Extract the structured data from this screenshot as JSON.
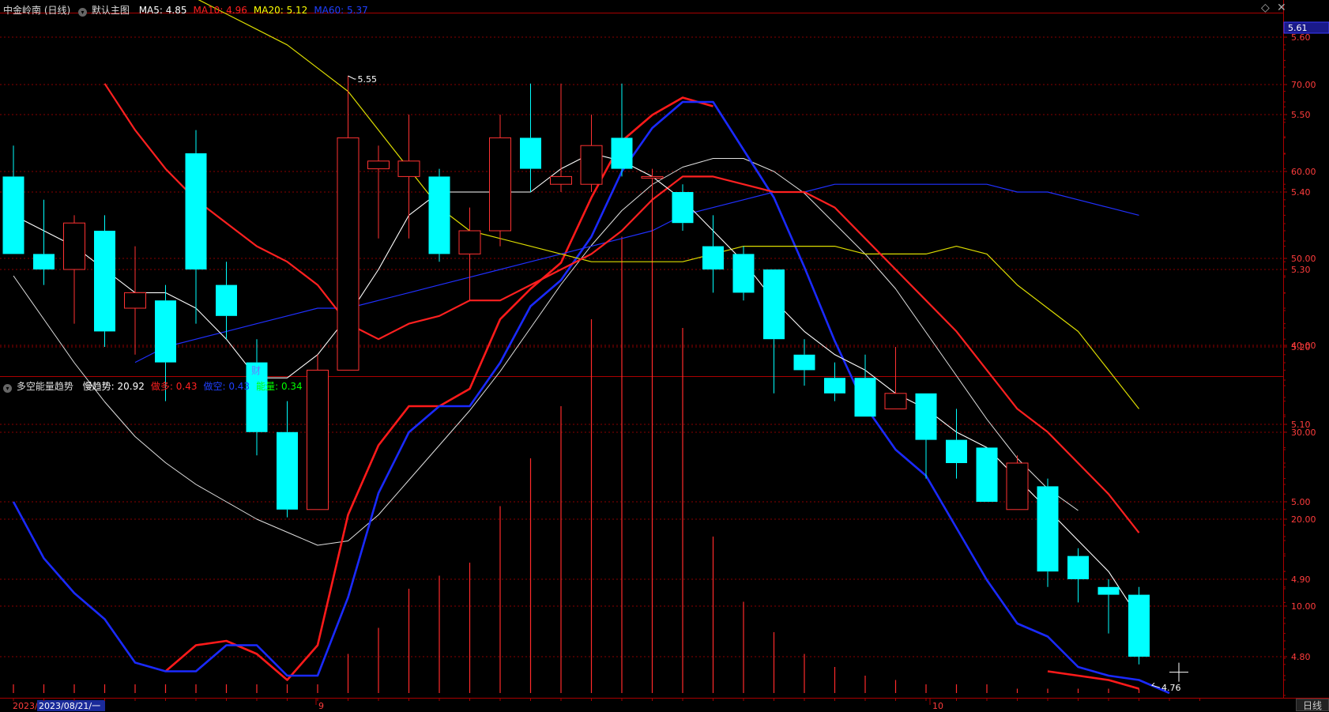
{
  "header": {
    "stock_name": "中金岭南 (日线)",
    "main_chart_label": "默认主图",
    "ma": [
      {
        "label": "MA5:",
        "value": "4.85",
        "color": "#ffffff"
      },
      {
        "label": "MA10:",
        "value": "4.96",
        "color": "#ff2020"
      },
      {
        "label": "MA20:",
        "value": "5.12",
        "color": "#ffff00"
      },
      {
        "label": "MA60:",
        "value": "5.37",
        "color": "#2040ff"
      }
    ]
  },
  "indicator_header": {
    "name": "多空能量趋势",
    "items": [
      {
        "label": "慢趋势:",
        "value": "20.92",
        "color": "#ffffff"
      },
      {
        "label": "做多:",
        "value": "0.43",
        "color": "#ff2020"
      },
      {
        "label": "做空:",
        "value": "0.43",
        "color": "#2040ff"
      },
      {
        "label": "能量:",
        "value": "0.34",
        "color": "#00ff00"
      }
    ]
  },
  "price_axis": {
    "current_price": "5.61",
    "ticks": [
      "5.60",
      "5.50",
      "5.40",
      "5.30",
      "5.20",
      "5.10",
      "5.00",
      "4.90",
      "4.80"
    ]
  },
  "indicator_axis": {
    "ticks": [
      "70.00",
      "60.00",
      "50.00",
      "40.00",
      "30.00",
      "20.00",
      "10.00"
    ]
  },
  "annotations": {
    "high_label": "5.55",
    "low_label": "4.76",
    "finance_marker": "财"
  },
  "date_axis": {
    "year_fragment": "2023/",
    "selected_date": "2023/08/21/一",
    "month_labels": [
      "9",
      "10"
    ]
  },
  "period_button": "日线",
  "colors": {
    "up": "#ff3232",
    "down": "#00ffff",
    "ma5": "#ffffff",
    "ma10": "#ff2020",
    "ma20": "#dcdc00",
    "ma60": "#2030ff",
    "grid": "#8a0000",
    "axis_text": "#ff3c3c"
  },
  "chart_data": {
    "type": "candlestick",
    "candles": [
      {
        "o": 5.42,
        "c": 5.32,
        "h": 5.46,
        "l": 5.32
      },
      {
        "o": 5.32,
        "c": 5.3,
        "h": 5.39,
        "l": 5.28
      },
      {
        "o": 5.3,
        "c": 5.36,
        "h": 5.37,
        "l": 5.23
      },
      {
        "o": 5.35,
        "c": 5.22,
        "h": 5.37,
        "l": 5.2
      },
      {
        "o": 5.25,
        "c": 5.27,
        "h": 5.33,
        "l": 5.19
      },
      {
        "o": 5.26,
        "c": 5.18,
        "h": 5.28,
        "l": 5.13
      },
      {
        "o": 5.45,
        "c": 5.3,
        "h": 5.48,
        "l": 5.23
      },
      {
        "o": 5.28,
        "c": 5.24,
        "h": 5.31,
        "l": 5.21
      },
      {
        "o": 5.18,
        "c": 5.09,
        "h": 5.21,
        "l": 5.06
      },
      {
        "o": 5.09,
        "c": 4.99,
        "h": 5.13,
        "l": 4.98
      },
      {
        "o": 4.99,
        "c": 5.17,
        "h": 5.19,
        "l": 4.99
      },
      {
        "o": 5.17,
        "c": 5.47,
        "h": 5.55,
        "l": 5.17
      },
      {
        "o": 5.43,
        "c": 5.44,
        "h": 5.46,
        "l": 5.34
      },
      {
        "o": 5.42,
        "c": 5.44,
        "h": 5.5,
        "l": 5.34
      },
      {
        "o": 5.42,
        "c": 5.32,
        "h": 5.43,
        "l": 5.31
      },
      {
        "o": 5.32,
        "c": 5.35,
        "h": 5.38,
        "l": 5.26
      },
      {
        "o": 5.35,
        "c": 5.47,
        "h": 5.5,
        "l": 5.33
      },
      {
        "o": 5.47,
        "c": 5.43,
        "h": 5.54,
        "l": 5.4
      },
      {
        "o": 5.41,
        "c": 5.42,
        "h": 5.54,
        "l": 5.4
      },
      {
        "o": 5.41,
        "c": 5.46,
        "h": 5.5,
        "l": 5.4
      },
      {
        "o": 5.47,
        "c": 5.43,
        "h": 5.54,
        "l": 5.42
      },
      {
        "o": 5.42,
        "c": 5.42,
        "h": 5.43,
        "l": 5.34
      },
      {
        "o": 5.4,
        "c": 5.36,
        "h": 5.41,
        "l": 5.35
      },
      {
        "o": 5.33,
        "c": 5.3,
        "h": 5.37,
        "l": 5.27
      },
      {
        "o": 5.32,
        "c": 5.27,
        "h": 5.33,
        "l": 5.26
      },
      {
        "o": 5.3,
        "c": 5.21,
        "h": 5.3,
        "l": 5.14
      },
      {
        "o": 5.19,
        "c": 5.17,
        "h": 5.21,
        "l": 5.15
      },
      {
        "o": 5.16,
        "c": 5.14,
        "h": 5.18,
        "l": 5.13
      },
      {
        "o": 5.16,
        "c": 5.11,
        "h": 5.19,
        "l": 5.11
      },
      {
        "o": 5.12,
        "c": 5.14,
        "h": 5.2,
        "l": 5.12
      },
      {
        "o": 5.14,
        "c": 5.08,
        "h": 5.14,
        "l": 5.03
      },
      {
        "o": 5.08,
        "c": 5.05,
        "h": 5.12,
        "l": 5.03
      },
      {
        "o": 5.07,
        "c": 5.0,
        "h": 5.07,
        "l": 5.0
      },
      {
        "o": 4.99,
        "c": 5.05,
        "h": 5.06,
        "l": 4.99
      },
      {
        "o": 5.02,
        "c": 4.91,
        "h": 5.03,
        "l": 4.89
      },
      {
        "o": 4.93,
        "c": 4.9,
        "h": 4.94,
        "l": 4.87
      },
      {
        "o": 4.89,
        "c": 4.88,
        "h": 4.9,
        "l": 4.83
      },
      {
        "o": 4.88,
        "c": 4.8,
        "h": 4.89,
        "l": 4.79
      }
    ],
    "ma5": [
      5.4,
      5.37,
      5.35,
      5.33,
      5.3,
      5.27,
      5.27,
      5.25,
      5.21,
      5.16,
      5.16,
      5.19,
      5.24,
      5.3,
      5.37,
      5.4,
      5.4,
      5.4,
      5.4,
      5.43,
      5.45,
      5.44,
      5.42,
      5.39,
      5.35,
      5.31,
      5.26,
      5.22,
      5.19,
      5.17,
      5.14,
      5.12,
      5.09,
      5.07,
      5.03,
      4.99,
      4.95,
      4.91,
      4.85
    ],
    "ma10": [
      5.54,
      5.48,
      5.43,
      5.39,
      5.36,
      5.33,
      5.31,
      5.28,
      5.23,
      5.21,
      5.23,
      5.24,
      5.26,
      5.26,
      5.28,
      5.3,
      5.32,
      5.35,
      5.39,
      5.42,
      5.42,
      5.41,
      5.4,
      5.4,
      5.38,
      5.34,
      5.3,
      5.26,
      5.22,
      5.17,
      5.12,
      5.09,
      5.05,
      5.01,
      4.96
    ],
    "ma20": [
      5.65,
      5.63,
      5.61,
      5.59,
      5.56,
      5.53,
      5.48,
      5.43,
      5.38,
      5.35,
      5.34,
      5.33,
      5.32,
      5.31,
      5.31,
      5.31,
      5.31,
      5.32,
      5.33,
      5.33,
      5.33,
      5.33,
      5.32,
      5.32,
      5.32,
      5.33,
      5.32,
      5.28,
      5.25,
      5.22,
      5.17,
      5.12
    ],
    "ma60": [
      5.18,
      5.2,
      5.21,
      5.22,
      5.23,
      5.24,
      5.25,
      5.25,
      5.26,
      5.27,
      5.28,
      5.29,
      5.3,
      5.31,
      5.32,
      5.33,
      5.34,
      5.35,
      5.37,
      5.38,
      5.39,
      5.4,
      5.4,
      5.41,
      5.41,
      5.41,
      5.41,
      5.41,
      5.41,
      5.4,
      5.4,
      5.39,
      5.38,
      5.37
    ],
    "indicator": {
      "slow_trend": [
        48,
        43,
        38,
        33.5,
        29.5,
        26.5,
        24,
        22,
        20,
        18.5,
        17,
        17.5,
        20.5,
        24.5,
        28.5,
        32.5,
        37,
        42,
        47,
        51.5,
        55.5,
        58.5,
        60.5,
        61.5,
        61.5,
        60,
        57.5,
        54,
        50.5,
        46.5,
        41.5,
        36.5,
        31.5,
        27,
        23.5,
        21
      ],
      "long_line": [
        null,
        null,
        null,
        null,
        null,
        2.5,
        5.5,
        6,
        4.5,
        1.5,
        5.5,
        20.5,
        28.5,
        33,
        33,
        35,
        43,
        46.5,
        49.5,
        57,
        63.5,
        66.5,
        68.5,
        67.5,
        null,
        null,
        null,
        null,
        null,
        null,
        null,
        null,
        null,
        null,
        2.5,
        2,
        1.5,
        0.5
      ],
      "short_line": [
        22,
        15.5,
        11.5,
        8.5,
        3.5,
        2.5,
        2.5,
        5.5,
        5.5,
        2,
        2,
        11,
        23,
        30,
        33,
        33,
        38,
        44.5,
        47.5,
        52.5,
        60,
        65,
        68,
        68,
        62.5,
        57,
        49,
        40.5,
        33,
        28,
        25,
        19,
        13,
        8,
        6.5,
        3,
        2,
        1.5,
        0
      ],
      "energy_bars": [
        1,
        1,
        1,
        1,
        1,
        1,
        1,
        1,
        1,
        1,
        1,
        4.5,
        7.5,
        12,
        13.5,
        15,
        21.5,
        27,
        33,
        43,
        52.5,
        57,
        42,
        18,
        10.5,
        7,
        4.5,
        3,
        2,
        1.5,
        1,
        1,
        1,
        0.5,
        0.5,
        0.5,
        0.5,
        0.5
      ]
    }
  }
}
